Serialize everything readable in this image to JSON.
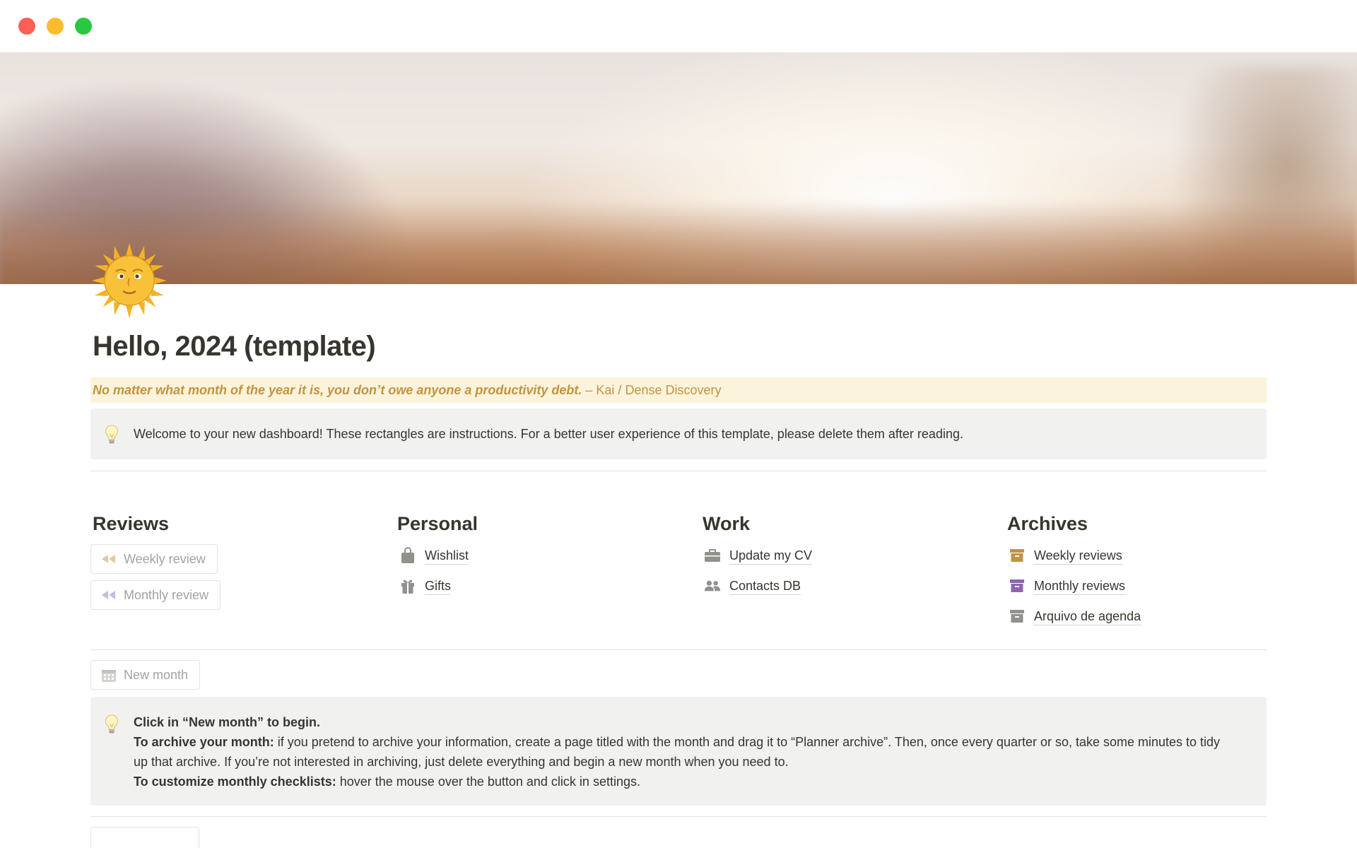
{
  "page": {
    "title": "Hello, 2024 (template)",
    "quote": {
      "emphasis": "No matter what month of the year it is, you don’t owe anyone a productivity debt.",
      "attribution": " – Kai / Dense Discovery"
    },
    "callout1": {
      "icon": "lightbulb-icon",
      "text": "Welcome to your new dashboard! These rectangles are instructions. For a better user experience of this template, please delete them after reading."
    }
  },
  "columns": {
    "reviews": {
      "heading": "Reviews",
      "buttons": [
        {
          "label": "Weekly review",
          "icon": "rewind-icon",
          "color": "#d9b98a"
        },
        {
          "label": "Monthly review",
          "icon": "rewind-icon",
          "color": "#b7a9d6"
        }
      ]
    },
    "personal": {
      "heading": "Personal",
      "links": [
        {
          "label": "Wishlist",
          "icon": "shopping-bag-icon"
        },
        {
          "label": "Gifts",
          "icon": "gift-icon"
        }
      ]
    },
    "work": {
      "heading": "Work",
      "links": [
        {
          "label": "Update my CV",
          "icon": "briefcase-icon"
        },
        {
          "label": "Contacts DB",
          "icon": "people-icon"
        }
      ]
    },
    "archives": {
      "heading": "Archives",
      "links": [
        {
          "label": "Weekly reviews",
          "icon": "archive-box-icon",
          "color": "#c29343"
        },
        {
          "label": "Monthly reviews",
          "icon": "archive-box-icon",
          "color": "#9065b0"
        },
        {
          "label": "Arquivo de agenda",
          "icon": "archive-box-icon",
          "color": "#91918e"
        }
      ]
    }
  },
  "new_month": {
    "label": "New month",
    "icon": "calendar-icon"
  },
  "callout2": {
    "icon": "lightbulb-icon",
    "line1": "Click in “New month” to begin.",
    "archive_label": "To archive your month:",
    "archive_text": " if you pretend to archive your information, create a page titled with the month and drag it to “Planner archive”. Then, once every quarter or so, take some minutes to tidy up that archive. If you’re not interested in archiving, just delete everything and begin a new month when you need to.",
    "customize_label": "To customize monthly checklists:",
    "customize_text": " hover the mouse over the button and click in settings."
  }
}
